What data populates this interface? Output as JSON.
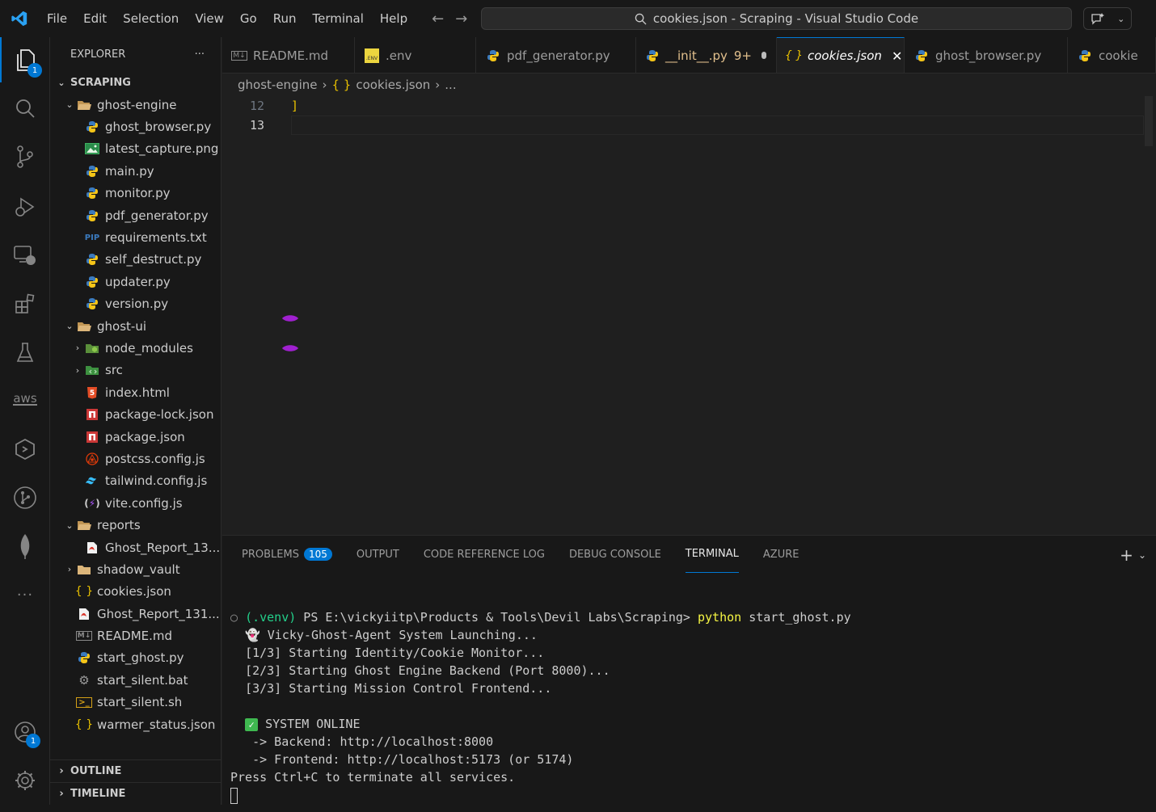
{
  "titlebar": {
    "menu": [
      "File",
      "Edit",
      "Selection",
      "View",
      "Go",
      "Run",
      "Terminal",
      "Help"
    ],
    "search_text": "cookies.json - Scraping - Visual Studio Code"
  },
  "activity": {
    "explorer_badge": "1",
    "accounts_badge": "1",
    "aws_label": "aws"
  },
  "sidebar": {
    "title": "EXPLORER",
    "more": "···",
    "section": "SCRAPING",
    "tree": [
      {
        "label": "ghost-engine",
        "indent": 1,
        "chev": "⌄",
        "icon": "folder-open"
      },
      {
        "label": "ghost_browser.py",
        "indent": 2,
        "icon": "python"
      },
      {
        "label": "latest_capture.png",
        "indent": 2,
        "icon": "image"
      },
      {
        "label": "main.py",
        "indent": 2,
        "icon": "python"
      },
      {
        "label": "monitor.py",
        "indent": 2,
        "icon": "python"
      },
      {
        "label": "pdf_generator.py",
        "indent": 2,
        "icon": "python"
      },
      {
        "label": "requirements.txt",
        "indent": 2,
        "icon": "pip"
      },
      {
        "label": "self_destruct.py",
        "indent": 2,
        "icon": "python"
      },
      {
        "label": "updater.py",
        "indent": 2,
        "icon": "python"
      },
      {
        "label": "version.py",
        "indent": 2,
        "icon": "python"
      },
      {
        "label": "ghost-ui",
        "indent": 1,
        "chev": "⌄",
        "icon": "folder-open"
      },
      {
        "label": "node_modules",
        "indent": 2,
        "chev": "›",
        "icon": "node-folder"
      },
      {
        "label": "src",
        "indent": 2,
        "chev": "›",
        "icon": "src-folder"
      },
      {
        "label": "index.html",
        "indent": 2,
        "icon": "html"
      },
      {
        "label": "package-lock.json",
        "indent": 2,
        "icon": "npm"
      },
      {
        "label": "package.json",
        "indent": 2,
        "icon": "npm"
      },
      {
        "label": "postcss.config.js",
        "indent": 2,
        "icon": "postcss"
      },
      {
        "label": "tailwind.config.js",
        "indent": 2,
        "icon": "tailwind"
      },
      {
        "label": "vite.config.js",
        "indent": 2,
        "icon": "vite"
      },
      {
        "label": "reports",
        "indent": 1,
        "chev": "⌄",
        "icon": "folder-open"
      },
      {
        "label": "Ghost_Report_13...",
        "indent": 2,
        "icon": "pdf"
      },
      {
        "label": "shadow_vault",
        "indent": 1,
        "chev": "›",
        "icon": "folder"
      },
      {
        "label": "cookies.json",
        "indent": 1,
        "icon": "json"
      },
      {
        "label": "Ghost_Report_131...",
        "indent": 1,
        "icon": "pdf"
      },
      {
        "label": "README.md",
        "indent": 1,
        "icon": "markdown"
      },
      {
        "label": "start_ghost.py",
        "indent": 1,
        "icon": "python"
      },
      {
        "label": "start_silent.bat",
        "indent": 1,
        "icon": "gear"
      },
      {
        "label": "start_silent.sh",
        "indent": 1,
        "icon": "shell"
      },
      {
        "label": "warmer_status.json",
        "indent": 1,
        "icon": "json"
      }
    ],
    "outline": "OUTLINE",
    "timeline": "TIMELINE"
  },
  "tabs": [
    {
      "label": "README.md",
      "icon": "markdown",
      "active": false
    },
    {
      "label": ".env",
      "icon": "env",
      "active": false
    },
    {
      "label": "pdf_generator.py",
      "icon": "python",
      "active": false
    },
    {
      "label": "__init__.py",
      "extra": "9+",
      "icon": "python",
      "active": false,
      "dirty": true
    },
    {
      "label": "cookies.json",
      "icon": "json",
      "active": true
    },
    {
      "label": "ghost_browser.py",
      "icon": "python",
      "active": false
    },
    {
      "label": "cookie",
      "icon": "python",
      "active": false
    }
  ],
  "breadcrumb": {
    "folder": "ghost-engine",
    "file": "cookies.json",
    "rest": "..."
  },
  "editor": {
    "lines": [
      {
        "no": "12",
        "code": "]"
      },
      {
        "no": "13",
        "code": ""
      }
    ]
  },
  "panel": {
    "tabs": [
      "PROBLEMS",
      "OUTPUT",
      "CODE REFERENCE LOG",
      "DEBUG CONSOLE",
      "TERMINAL",
      "AZURE"
    ],
    "problems_count": "105",
    "active_tab": "TERMINAL",
    "terminal": {
      "venv": "(.venv)",
      "prompt": " PS E:\\vickyiitp\\Products & Tools\\Devil Labs\\Scraping> ",
      "cmd_python": "python",
      "cmd_arg": " start_ghost.py",
      "lines": [
        "👻 Vicky-Ghost-Agent System Launching...",
        "[1/3] Starting Identity/Cookie Monitor...",
        "[2/3] Starting Ghost Engine Backend (Port 8000)...",
        "[3/3] Starting Mission Control Frontend..."
      ],
      "online": " SYSTEM ONLINE",
      "backend": "   -> Backend: http://localhost:8000",
      "frontend": "   -> Frontend: http://localhost:5173 (or 5174)",
      "press": "Press Ctrl+C to terminate all services."
    }
  },
  "colors": {
    "accent": "#0078d4",
    "background": "#1f1f1f",
    "sidebar": "#181818"
  }
}
